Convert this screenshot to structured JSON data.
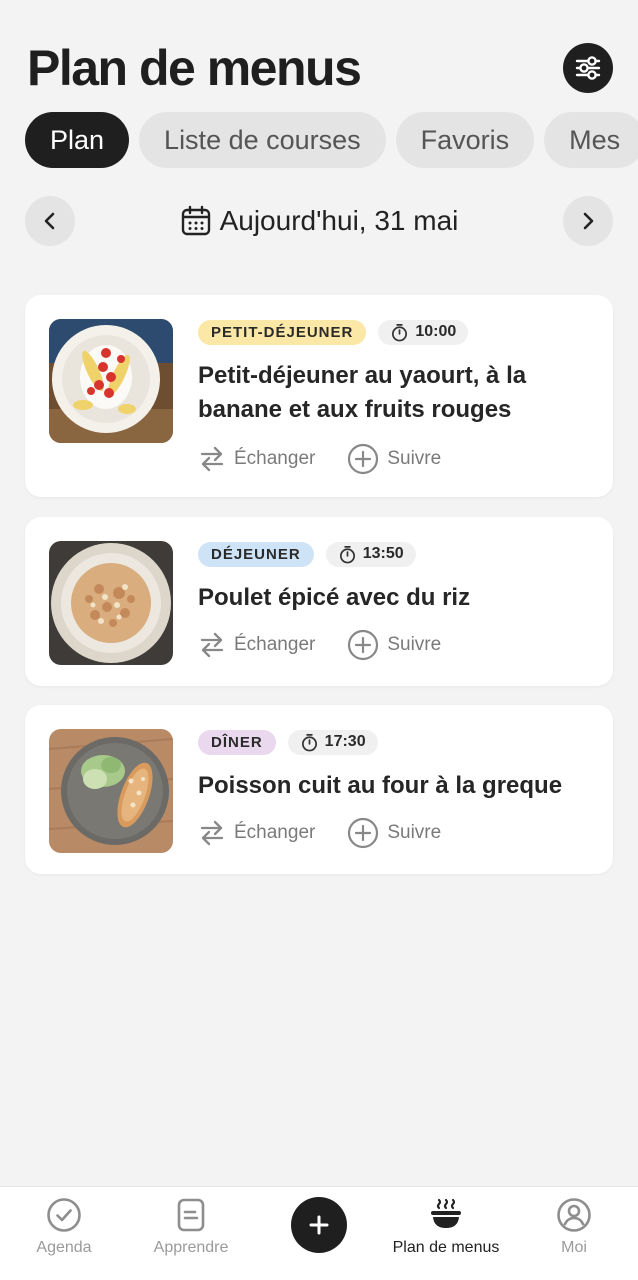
{
  "header": {
    "title": "Plan de menus"
  },
  "tabs": [
    {
      "label": "Plan",
      "active": true
    },
    {
      "label": "Liste de courses",
      "active": false
    },
    {
      "label": "Favoris",
      "active": false
    },
    {
      "label": "Mes",
      "active": false
    }
  ],
  "date_nav": {
    "label": "Aujourd'hui, 31 mai"
  },
  "meals": [
    {
      "type": "PETIT-DÉJEUNER",
      "type_color": "#fbe7a6",
      "time": "10:00",
      "title_line1": "Petit-déjeuner au yaourt, à la",
      "title_line2": "banane et aux fruits rouges"
    },
    {
      "type": "DÉJEUNER",
      "type_color": "#cfe3f7",
      "time": "13:50",
      "title_line1": "Poulet épicé avec du riz",
      "title_line2": ""
    },
    {
      "type": "DÎNER",
      "type_color": "#ead8ee",
      "time": "17:30",
      "title_line1": "Poisson cuit au four à la greque",
      "title_line2": ""
    }
  ],
  "actions": {
    "swap_label": "Échanger",
    "track_label": "Suivre"
  },
  "bottom_nav": {
    "items": [
      {
        "label": "Agenda",
        "icon": "check-circle-icon"
      },
      {
        "label": "Apprendre",
        "icon": "document-icon"
      },
      {
        "label": "Plan de menus",
        "icon": "bowl-icon",
        "active": true
      },
      {
        "label": "Moi",
        "icon": "user-circle-icon"
      }
    ]
  }
}
